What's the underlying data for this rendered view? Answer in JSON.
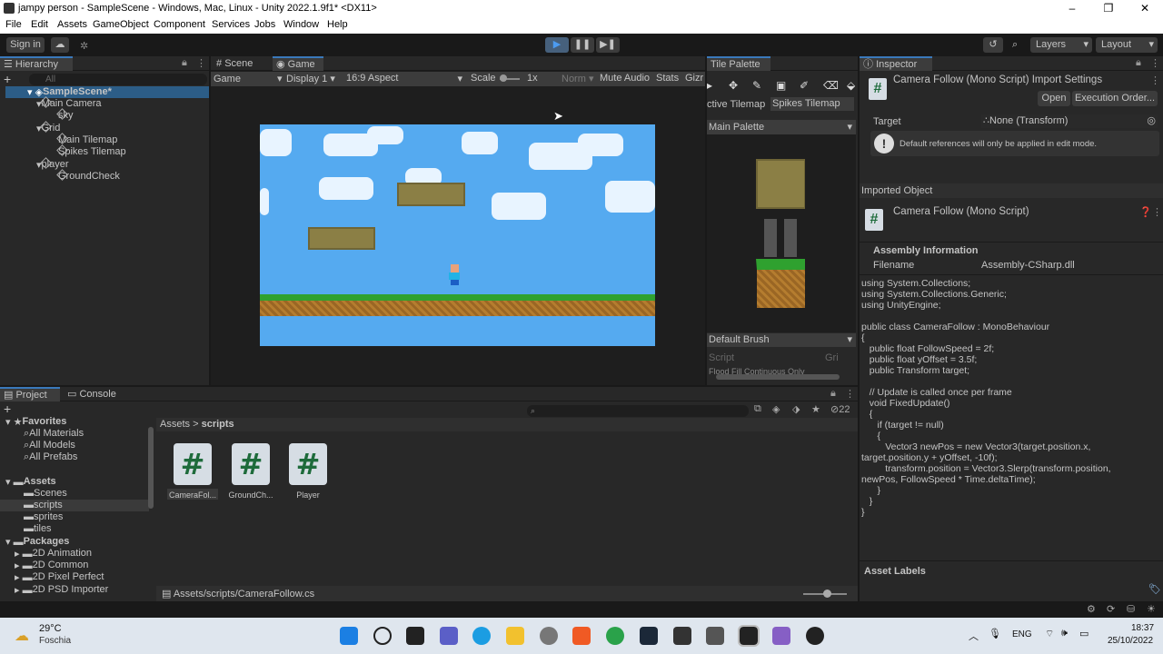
{
  "window": {
    "title": "jampy person - SampleScene - Windows, Mac, Linux - Unity 2022.1.9f1* <DX11>",
    "minimize": "–",
    "maximize": "❐",
    "close": "✕"
  },
  "menu": [
    "File",
    "Edit",
    "Assets",
    "GameObject",
    "Component",
    "Services",
    "Jobs",
    "Window",
    "Help"
  ],
  "toolbar": {
    "sign_in": "Sign in",
    "layers": "Layers",
    "layout": "Layout"
  },
  "hierarchy": {
    "tab": "Hierarchy",
    "search_placeholder": "All",
    "items": [
      "SampleScene*",
      "Main Camera",
      "sky",
      "Grid",
      "Main Tilemap",
      "Spikes Tilemap",
      "player",
      "GroundCheck"
    ]
  },
  "game": {
    "tabs": [
      "Scene",
      "Game"
    ],
    "display_mode": "Game",
    "display": "Display 1",
    "aspect": "16:9 Aspect",
    "scale_label": "Scale",
    "scale_value": "1x",
    "norm": "Norm",
    "mute": "Mute Audio",
    "stats": "Stats",
    "gizmos": "Gizr"
  },
  "tile_palette": {
    "tab": "Tile Palette",
    "active_tilemap": "ctive Tilemap",
    "tilemap": "Spikes Tilemap",
    "palette": "Main Palette",
    "brush": "Default Brush",
    "script": "Script",
    "grid": "Gri",
    "flood": "Flood Fill Continuous Only"
  },
  "inspector": {
    "tab": "Inspector",
    "title": "Camera Follow (Mono Script) Import Settings",
    "open": "Open",
    "exec_order": "Execution Order...",
    "target_label": "Target",
    "target_value": "None (Transform)",
    "warning": "Default references will only be applied in edit mode.",
    "imported_object": "Imported Object",
    "script_name": "Camera Follow (Mono Script)",
    "assembly_info": "Assembly Information",
    "filename_label": "Filename",
    "filename_value": "Assembly-CSharp.dll",
    "code": "using System.Collections;\nusing System.Collections.Generic;\nusing UnityEngine;\n\npublic class CameraFollow : MonoBehaviour\n{\n   public float FollowSpeed = 2f;\n   public float yOffset = 3.5f;\n   public Transform target;\n\n   // Update is called once per frame\n   void FixedUpdate()\n   {\n      if (target != null)\n      {\n         Vector3 newPos = new Vector3(target.position.x,\ntarget.position.y + yOffset, -10f);\n         transform.position = Vector3.Slerp(transform.position,\nnewPos, FollowSpeed * Time.deltaTime);\n      }\n   }\n}",
    "asset_labels": "Asset Labels"
  },
  "project": {
    "tabs": [
      "Project",
      "Console"
    ],
    "favorites": "Favorites",
    "fav_items": [
      "All Materials",
      "All Models",
      "All Prefabs"
    ],
    "assets": "Assets",
    "asset_items": [
      "Scenes",
      "scripts",
      "sprites",
      "tiles"
    ],
    "packages": "Packages",
    "package_items": [
      "2D Animation",
      "2D Common",
      "2D Pixel Perfect",
      "2D PSD Importer"
    ],
    "breadcrumb_root": "Assets",
    "breadcrumb_sep": ">",
    "breadcrumb_current": "scripts",
    "files": [
      "CameraFol...",
      "GroundCh...",
      "Player"
    ],
    "path": "Assets/scripts/CameraFollow.cs",
    "count": "22"
  },
  "taskbar": {
    "weather_temp": "29°C",
    "weather_desc": "Foschia",
    "lang": "ENG",
    "time": "18:37",
    "date": "25/10/2022"
  },
  "colors": {
    "accent": "#3a79bb",
    "sky": "#55aaf0",
    "grass": "#2fa12f",
    "dirt": "#a8722a"
  }
}
